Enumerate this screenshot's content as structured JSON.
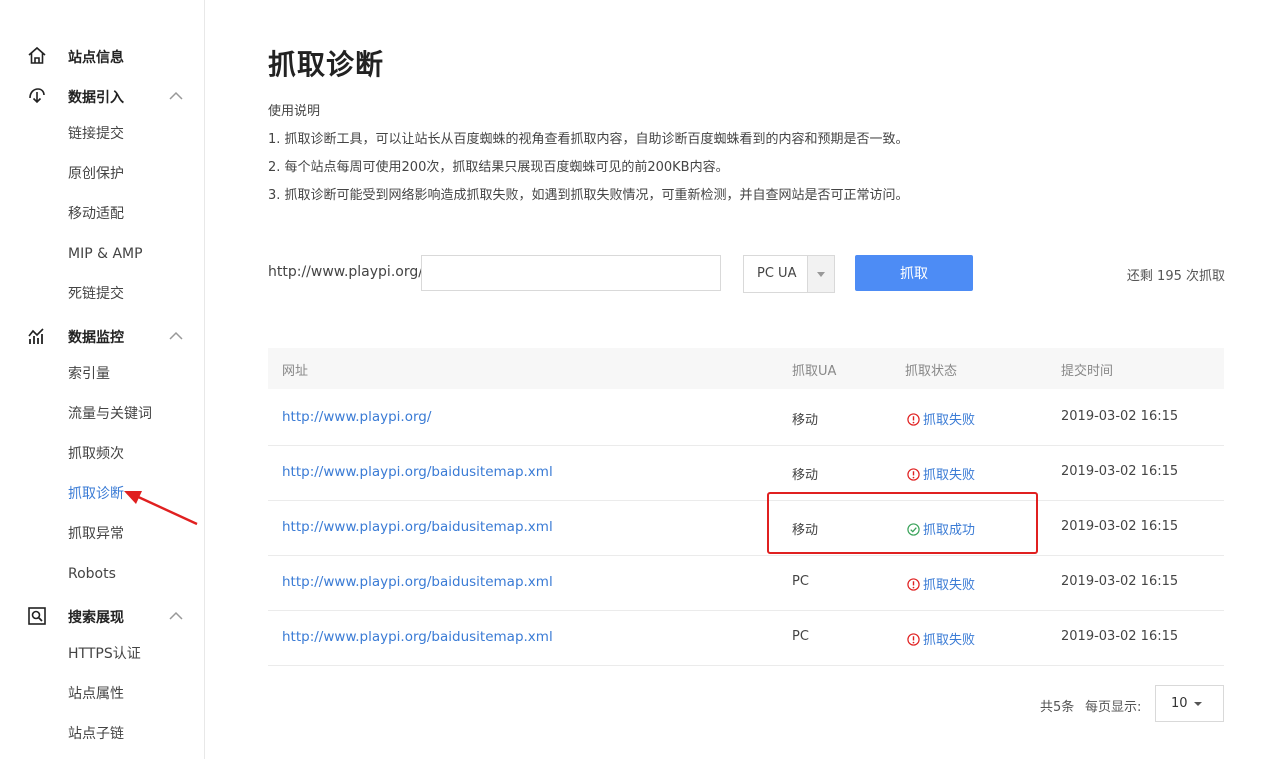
{
  "sidebar": {
    "site_info": "站点信息",
    "data_import": {
      "label": "数据引入",
      "items": [
        "链接提交",
        "原创保护",
        "移动适配",
        "MIP & AMP",
        "死链提交"
      ]
    },
    "data_monitor": {
      "label": "数据监控",
      "items": [
        "索引量",
        "流量与关键词",
        "抓取频次",
        "抓取诊断",
        "抓取异常",
        "Robots"
      ]
    },
    "search_display": {
      "label": "搜索展现",
      "items": [
        "HTTPS认证",
        "站点属性",
        "站点子链"
      ]
    }
  },
  "main": {
    "title": "抓取诊断",
    "intro": [
      "使用说明",
      "1. 抓取诊断工具，可以让站长从百度蜘蛛的视角查看抓取内容，自助诊断百度蜘蛛看到的内容和预期是否一致。",
      "2. 每个站点每周可使用200次，抓取结果只展现百度蜘蛛可见的前200KB内容。",
      "3. 抓取诊断可能受到网络影响造成抓取失败，如遇到抓取失败情况，可重新检测，并自查网站是否可正常访问。"
    ],
    "url_prefix": "http://www.playpi.org/",
    "url_input_value": "",
    "ua_select": "PC UA",
    "fetch_button": "抓取",
    "remaining": "还剩 195 次抓取"
  },
  "table": {
    "headers": [
      "网址",
      "抓取UA",
      "抓取状态",
      "提交时间"
    ],
    "rows": [
      {
        "url": "http://www.playpi.org/",
        "ua": "移动",
        "status": "抓取失败",
        "ok": false,
        "time": "2019-03-02 16:15"
      },
      {
        "url": "http://www.playpi.org/baidusitemap.xml",
        "ua": "移动",
        "status": "抓取失败",
        "ok": false,
        "time": "2019-03-02 16:15"
      },
      {
        "url": "http://www.playpi.org/baidusitemap.xml",
        "ua": "移动",
        "status": "抓取成功",
        "ok": true,
        "time": "2019-03-02 16:15"
      },
      {
        "url": "http://www.playpi.org/baidusitemap.xml",
        "ua": "PC",
        "status": "抓取失败",
        "ok": false,
        "time": "2019-03-02 16:15"
      },
      {
        "url": "http://www.playpi.org/baidusitemap.xml",
        "ua": "PC",
        "status": "抓取失败",
        "ok": false,
        "time": "2019-03-02 16:15"
      }
    ]
  },
  "pagination": {
    "total": "共5条",
    "per_page_label": "每页显示:",
    "per_page_value": "10"
  },
  "colors": {
    "accent": "#3a7bd5",
    "button": "#4d8cf5",
    "error": "#e02020",
    "success": "#3aa35a",
    "annotation": "#e02020"
  }
}
